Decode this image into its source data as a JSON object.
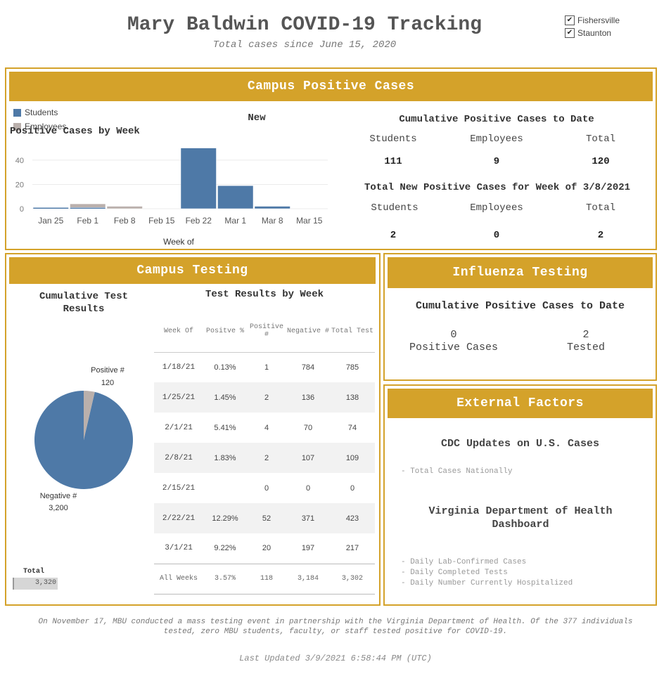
{
  "header": {
    "title": "Mary Baldwin COVID-19 Tracking",
    "subtitle": "Total cases since June 15, 2020"
  },
  "filters": [
    {
      "label": "Fishersville",
      "checked": true
    },
    {
      "label": "Staunton",
      "checked": true
    }
  ],
  "campus_positive": {
    "banner": "Campus Positive Cases",
    "legend": [
      {
        "label": "Students",
        "color": "#4e79a7"
      },
      {
        "label": "Employees",
        "color": "#bab0ac"
      }
    ],
    "chart_title_line1": "New",
    "chart_title_line2": "Positive Cases by Week",
    "cumulative_title": "Cumulative Positive Cases to Date",
    "cumulative": {
      "students_label": "Students",
      "employees_label": "Employees",
      "total_label": "Total",
      "students": "111",
      "employees": "9",
      "total": "120"
    },
    "week_title": "Total New Positive Cases for Week of 3/8/2021",
    "week": {
      "students_label": "Students",
      "employees_label": "Employees",
      "total_label": "Total",
      "students": "2",
      "employees": "0",
      "total": "2"
    }
  },
  "chart_data": {
    "type": "bar",
    "stacked": true,
    "categories": [
      "Jan 25",
      "Feb 1",
      "Feb 8",
      "Feb 15",
      "Feb 22",
      "Mar 1",
      "Mar 8",
      "Mar 15"
    ],
    "series": [
      {
        "name": "Students",
        "values": [
          1,
          1,
          0,
          0,
          50,
          19,
          2,
          0
        ]
      },
      {
        "name": "Employees",
        "values": [
          0,
          3,
          2,
          0,
          0,
          0,
          0,
          0
        ]
      }
    ],
    "title": "New Positive Cases by Week",
    "xlabel": "Week of",
    "ylabel": "",
    "yticks": [
      0,
      20,
      40
    ],
    "ylim": [
      0,
      55
    ],
    "grid": true,
    "legend": "top-left"
  },
  "campus_testing": {
    "banner": "Campus Testing",
    "pie_title": "Cumulative Test Results",
    "pie": {
      "positive_label": "Positive #",
      "positive_value": "120",
      "positive": 120,
      "negative_label": "Negative #",
      "negative_value": "3,200",
      "negative": 3200,
      "positive_color": "#bab0ac",
      "negative_color": "#4e79a7"
    },
    "total_label": "Total",
    "total_value": "3,320",
    "table_title": "Test Results by Week",
    "columns": [
      "Week Of",
      "Positve %",
      "Positive #",
      "Negative #",
      "Total Test"
    ],
    "rows": [
      [
        "1/18/21",
        "0.13%",
        "1",
        "784",
        "785"
      ],
      [
        "1/25/21",
        "1.45%",
        "2",
        "136",
        "138"
      ],
      [
        "2/1/21",
        "5.41%",
        "4",
        "70",
        "74"
      ],
      [
        "2/8/21",
        "1.83%",
        "2",
        "107",
        "109"
      ],
      [
        "2/15/21",
        "",
        "0",
        "0",
        "0"
      ],
      [
        "2/22/21",
        "12.29%",
        "52",
        "371",
        "423"
      ],
      [
        "3/1/21",
        "9.22%",
        "20",
        "197",
        "217"
      ]
    ],
    "footer": [
      "All Weeks",
      "3.57%",
      "118",
      "3,184",
      "3,302"
    ]
  },
  "influenza": {
    "banner": "Influenza Testing",
    "title": "Cumulative Positive Cases to Date",
    "positive_value": "0",
    "positive_label": "Positive Cases",
    "tested_value": "2",
    "tested_label": "Tested"
  },
  "external": {
    "banner": "External Factors",
    "cdc_title": "CDC Updates on U.S. Cases",
    "cdc_items": [
      "- Total Cases Nationally"
    ],
    "vdh_title": "Virginia Department of Health Dashboard",
    "vdh_items": [
      "- Daily Lab-Confirmed Cases",
      "- Daily Completed Tests",
      "- Daily Number Currently Hospitalized"
    ]
  },
  "footer": {
    "note": "On November 17, MBU conducted a mass testing event in partnership with the Virginia Department of Health. Of the 377 individuals tested, zero MBU students, faculty, or staff tested positive for COVID-19.",
    "updated": "Last Updated 3/9/2021 6:58:44 PM (UTC)"
  }
}
